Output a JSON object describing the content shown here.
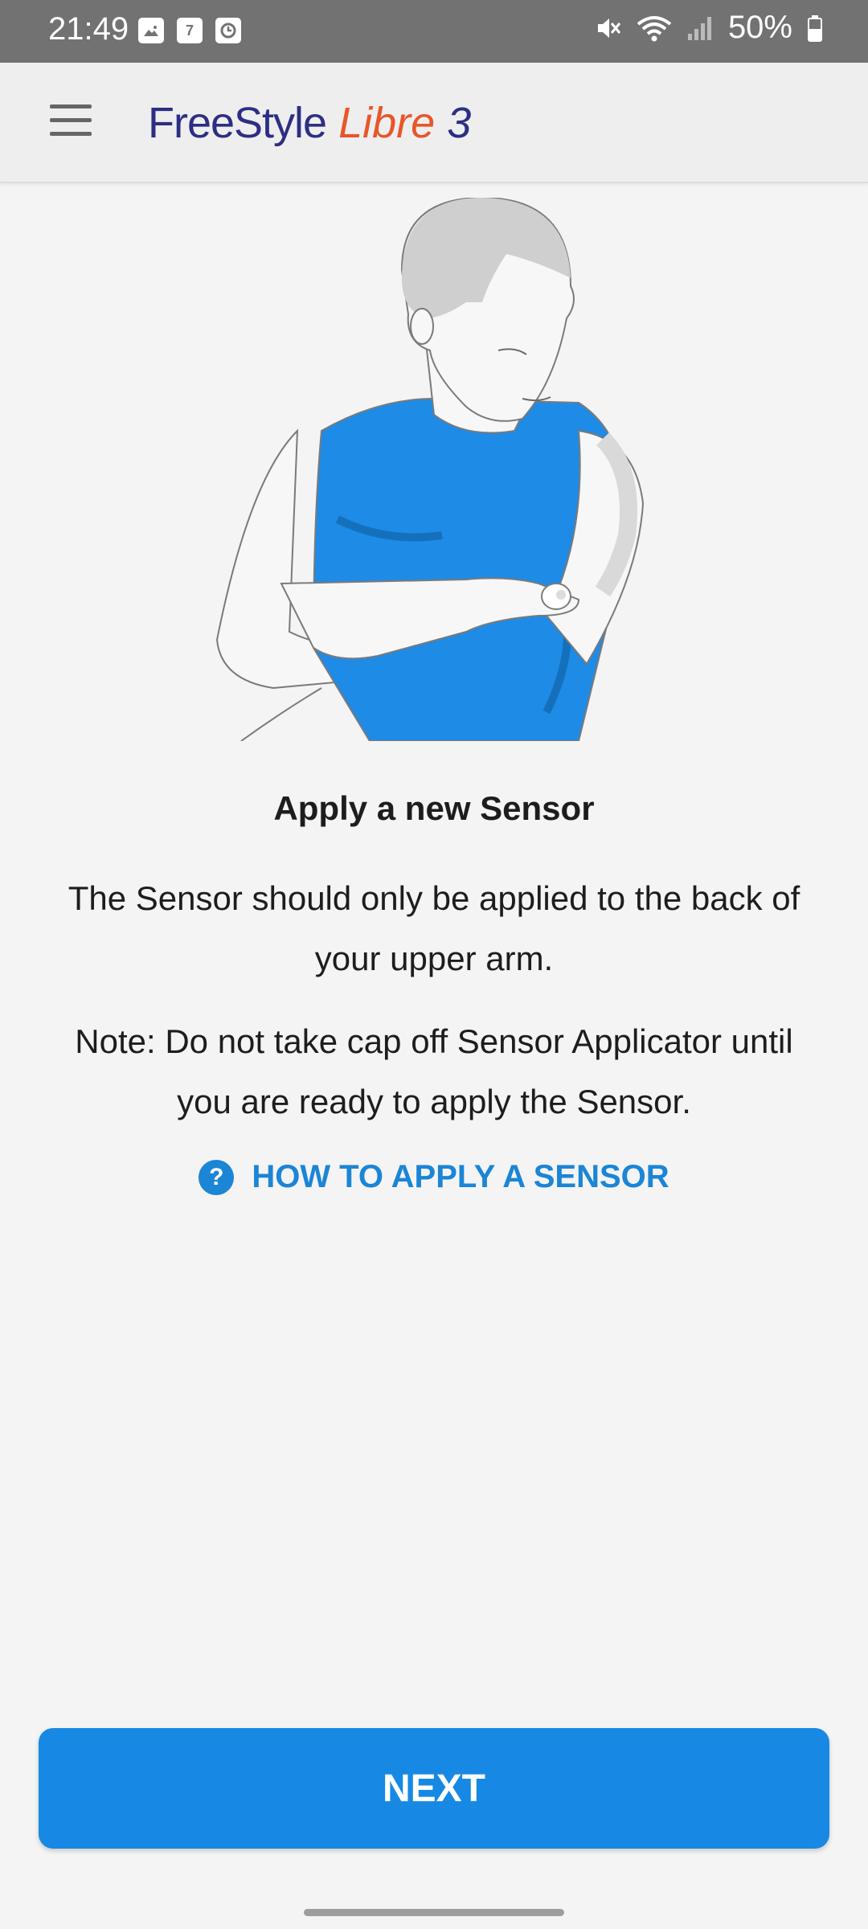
{
  "status_bar": {
    "time": "21:49",
    "notification_icons": [
      "gallery-icon",
      "calendar-icon",
      "clock-icon"
    ],
    "calendar_day": "7",
    "battery_percent": "50%",
    "icons": [
      "mute-icon",
      "wifi-icon",
      "signal-icon",
      "battery-icon"
    ]
  },
  "app_bar": {
    "logo_freestyle": "FreeStyle",
    "logo_libre": "Libre",
    "logo_number": "3",
    "menu_icon": "hamburger-menu-icon"
  },
  "content": {
    "title": "Apply a new Sensor",
    "paragraph_1": "The Sensor should only be applied to the back of your upper arm.",
    "paragraph_2": "Note: Do not take cap off Sensor Applicator until you are ready to apply the Sensor.",
    "how_to_link": "HOW TO APPLY A SENSOR",
    "help_icon_glyph": "?"
  },
  "actions": {
    "next_label": "NEXT"
  },
  "colors": {
    "accent": "#1789e4",
    "link": "#1b85d6",
    "logo_blue": "#2d2e83",
    "logo_orange": "#e8562a",
    "shirt_blue": "#1e8be6"
  }
}
